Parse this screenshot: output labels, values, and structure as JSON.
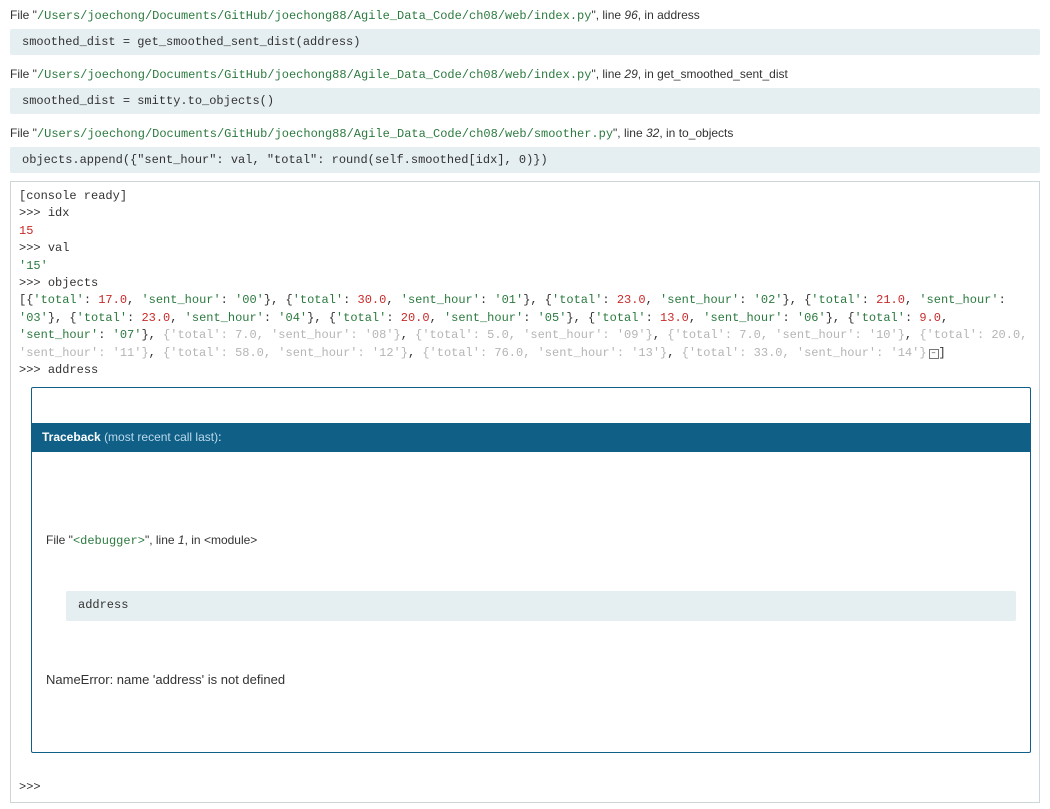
{
  "frames": [
    {
      "file": "/Users/joechong/Documents/GitHub/joechong88/Agile_Data_Code/ch08/web/index.py",
      "line": "96",
      "fn": "address",
      "code": "smoothed_dist = get_smoothed_sent_dist(address)"
    },
    {
      "file": "/Users/joechong/Documents/GitHub/joechong88/Agile_Data_Code/ch08/web/index.py",
      "line": "29",
      "fn": "get_smoothed_sent_dist",
      "code": "smoothed_dist = smitty.to_objects()"
    },
    {
      "file": "/Users/joechong/Documents/GitHub/joechong88/Agile_Data_Code/ch08/web/smoother.py",
      "line": "32",
      "fn": "to_objects",
      "code": "objects.append({\"sent_hour\": val, \"total\": round(self.smoothed[idx], 0)})"
    }
  ],
  "console": {
    "ready": "[console ready]",
    "prompt": ">>> ",
    "lines": [
      {
        "in": "idx",
        "out_num": "15"
      },
      {
        "in": "val",
        "out_str": "'15'"
      }
    ],
    "objects_label": "objects",
    "objects_bright": [
      {
        "total": "17.0",
        "sent_hour": "'00'"
      },
      {
        "total": "30.0",
        "sent_hour": "'01'"
      },
      {
        "total": "23.0",
        "sent_hour": "'02'"
      },
      {
        "total": "21.0",
        "sent_hour": "'03'"
      },
      {
        "total": "23.0",
        "sent_hour": "'04'"
      },
      {
        "total": "20.0",
        "sent_hour": "'05'"
      },
      {
        "total": "13.0",
        "sent_hour": "'06'"
      },
      {
        "total": "9.0",
        "sent_hour": "'07'"
      }
    ],
    "objects_dim": [
      {
        "total": "7.0",
        "sent_hour": "'08'"
      },
      {
        "total": "5.0",
        "sent_hour": "'09'"
      },
      {
        "total": "7.0",
        "sent_hour": "'10'"
      },
      {
        "total": "20.0",
        "sent_hour": "'11'"
      },
      {
        "total": "58.0",
        "sent_hour": "'12'"
      },
      {
        "total": "76.0",
        "sent_hour": "'13'"
      },
      {
        "total": "33.0",
        "sent_hour": "'14'"
      }
    ],
    "address_in": "address",
    "final_prompt": ">>>"
  },
  "traceback": {
    "title": "Traceback",
    "subtitle": "(most recent call last)",
    "file": "<debugger>",
    "line": "1",
    "fn": "<module>",
    "code": "address",
    "error": "NameError: name 'address' is not defined"
  },
  "labels": {
    "file_word": "File ",
    "line_word": ", line ",
    "in_word": ", in ",
    "total_key": "'total'",
    "sent_hour_key": "'sent_hour'",
    "expand": "–"
  }
}
